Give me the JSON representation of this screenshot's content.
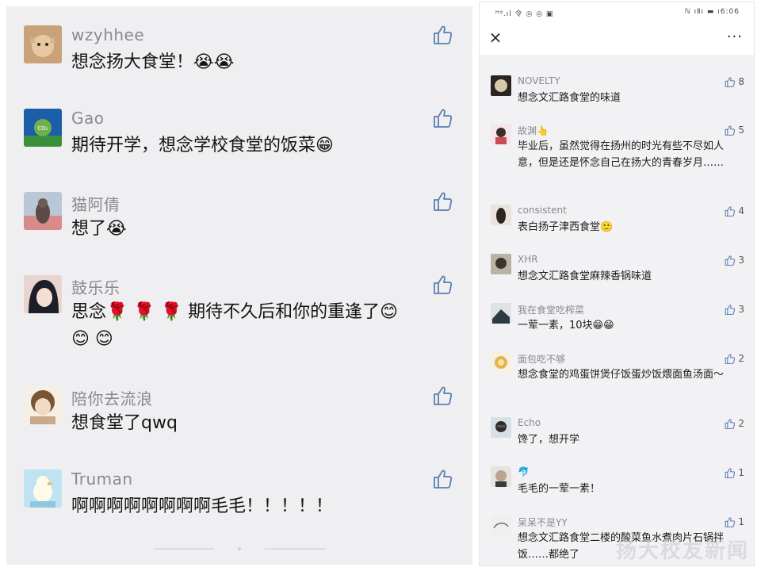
{
  "left_comments": [
    {
      "name": "wzyhhee",
      "text": "想念扬大食堂！😭😭",
      "avatar": "cat-photo-avatar"
    },
    {
      "name": "Gao",
      "text": "期待开学，想念学校食堂的饭菜😁",
      "avatar": "co2-globe-avatar"
    },
    {
      "name": "猫阿倩",
      "text": "想了😭",
      "avatar": "cat-figure-avatar"
    },
    {
      "name": "鼓乐乐",
      "text": "思念🌹 🌹 🌹 期待不久后和你的重逢了😊",
      "text2": "😊 😊",
      "avatar": "anime-girl-avatar"
    },
    {
      "name": "陪你去流浪",
      "text": "想食堂了qwq",
      "avatar": "cartoon-girl-avatar"
    },
    {
      "name": "Truman",
      "text": "啊啊啊啊啊啊啊啊毛毛！！！！！",
      "avatar": "cartoon-duck-avatar"
    }
  ],
  "right_status": {
    "left": "ᴴᵈ.ıl 令 ◎ ◎ ▣",
    "right": "ℕ ıⅡı ▬ ı6:06"
  },
  "right_nav": {
    "close": "×",
    "more": "···"
  },
  "right_comments": [
    {
      "name": "NOVELTY",
      "text": "想念文汇路食堂的味道",
      "likes": "8"
    },
    {
      "name": "故渊👆",
      "text": "毕业后，虽然觉得在扬州的时光有些不尽如人意，但是还是怀念自己在扬大的青春岁月……",
      "likes": "5"
    },
    {
      "name": "consistent",
      "text": "表白扬子津西食堂🙂",
      "likes": "4"
    },
    {
      "name": "XHR",
      "text": "想念文汇路食堂麻辣香锅味道",
      "likes": "3"
    },
    {
      "name": "我在食堂吃榨菜",
      "text": "一荤一素，10块😁😁",
      "likes": "3"
    },
    {
      "name": "面包吃不够",
      "text": "想念食堂的鸡蛋饼煲仔饭蛋炒饭煨面鱼汤面～",
      "likes": "2"
    },
    {
      "name": "Echo",
      "text": "馋了，想开学",
      "likes": "2"
    },
    {
      "name": "🐬",
      "text": "毛毛的一荤一素！",
      "likes": "1"
    },
    {
      "name": "呆呆不是YY",
      "text": "想念文汇路食堂二楼的酸菜鱼水煮肉片石锅拌饭……都绝了",
      "likes": "1"
    }
  ],
  "watermark": "扬大校友新闻",
  "colors": {
    "left_bg": "#efeff1",
    "right_bg": "#f2f2f4",
    "name_gray": "#8a8a8f",
    "like_stroke": "#5a7fb0"
  }
}
